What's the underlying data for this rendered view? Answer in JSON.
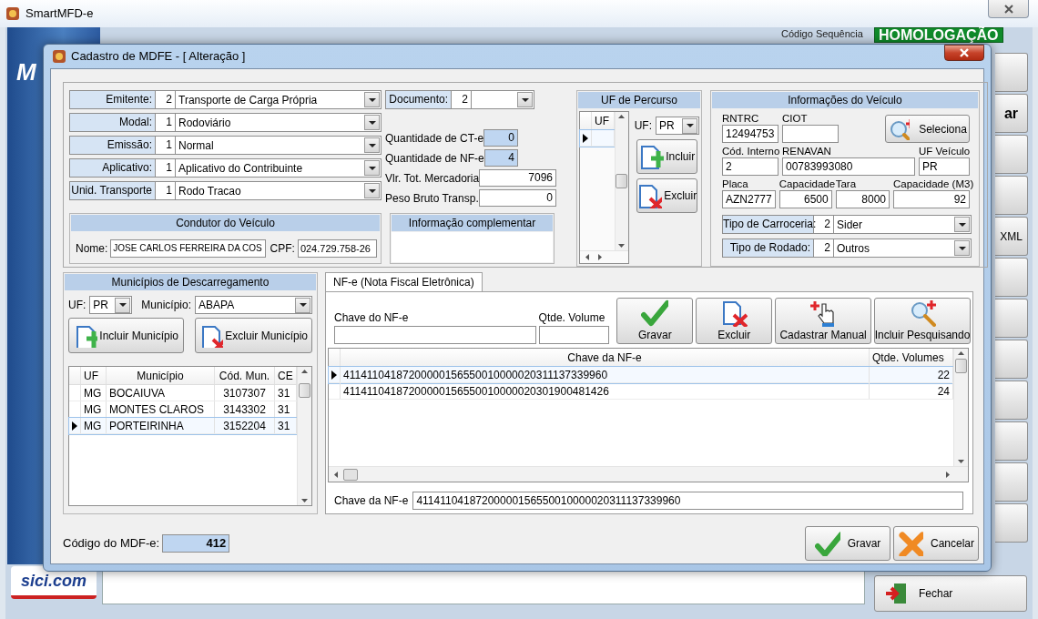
{
  "app": {
    "title": "SmartMFD-e",
    "logo_letter": "M",
    "sequence_label": "Código Sequência",
    "environment": "HOMOLOGAÇÃO",
    "side_buttons": [
      {
        "label": "ar",
        "bold": true
      },
      {
        "label": "XML",
        "bold": false
      }
    ],
    "close_button": "Fechar",
    "footer_logo": "sici.com"
  },
  "dialog": {
    "title": "Cadastro de MDFE - [ Alteração ]"
  },
  "combos": [
    {
      "label": "Emitente:",
      "code": "2",
      "value": "Transporte de Carga Própria"
    },
    {
      "label": "Modal:",
      "code": "1",
      "value": "Rodoviário"
    },
    {
      "label": "Emissão:",
      "code": "1",
      "value": "Normal"
    },
    {
      "label": "Aplicativo:",
      "code": "1",
      "value": "Aplicativo do Contribuinte"
    },
    {
      "label": "Unid. Transporte",
      "code": "1",
      "value": "Rodo Tracao"
    }
  ],
  "document": {
    "label": "Documento:",
    "code": "2"
  },
  "totals": [
    {
      "label": "Quantidade de CT-e",
      "value": "0",
      "readonly": true
    },
    {
      "label": "Quantidade de NF-e",
      "value": "4",
      "readonly": true
    },
    {
      "label": "Vlr. Tot. Mercadoria",
      "value": "7096",
      "readonly": false
    },
    {
      "label": "Peso Bruto Transp.",
      "value": "0",
      "readonly": false
    }
  ],
  "driver": {
    "title": "Condutor do Veículo",
    "name_label": "Nome:",
    "name": "JOSE CARLOS FERREIRA DA COS",
    "cpf_label": "CPF:",
    "cpf": "024.729.758-26"
  },
  "complement": {
    "title": "Informação complementar"
  },
  "route": {
    "title": "UF de Percurso",
    "column": "UF",
    "rows": [
      {
        "selected": true
      }
    ],
    "uf_label": "UF:",
    "uf": "PR",
    "buttons": [
      {
        "label": "Incluir",
        "kind": "add"
      },
      {
        "label": "Excluir",
        "kind": "delete"
      }
    ]
  },
  "vehicle": {
    "title": "Informações do Veículo",
    "select_button": "Seleciona",
    "fields": [
      {
        "label": "RNTRC",
        "value": "12494753",
        "kind": "text"
      },
      {
        "label": "CIOT",
        "kind": "text"
      },
      {
        "label": "Cód. Interno",
        "value": "2",
        "kind": "text"
      },
      {
        "label": "RENAVAN",
        "value": "00783993080",
        "kind": "text"
      },
      {
        "label": "UF Veículo",
        "value": "PR",
        "kind": "text"
      },
      {
        "label": "Placa",
        "value": "AZN2777",
        "kind": "text"
      },
      {
        "label": "Capacidade",
        "value": "6500",
        "kind": "number"
      },
      {
        "label": "Tara",
        "value": "8000",
        "kind": "number"
      },
      {
        "label": "Capacidade (M3)",
        "value": "92",
        "kind": "number"
      }
    ],
    "combos": [
      {
        "label": "Tipo de Carroceria:",
        "code": "2",
        "value": "Sider"
      },
      {
        "label": "Tipo de Rodado:",
        "code": "2",
        "value": "Outros"
      }
    ]
  },
  "municipios": {
    "title": "Municípios de Descarregamento",
    "uf_label": "UF:",
    "uf": "PR",
    "municipio_label": "Município:",
    "municipio": "ABAPA",
    "buttons": [
      {
        "label": "Incluir Município",
        "kind": "add"
      },
      {
        "label": "Excluir Município",
        "kind": "delete"
      }
    ],
    "columns": [
      "UF",
      "Município",
      "Cód. Mun.",
      "CE"
    ],
    "rows": [
      {
        "cells": [
          "MG",
          "BOCAIUVA",
          "3107307",
          "31"
        ],
        "selected": false
      },
      {
        "cells": [
          "MG",
          "MONTES CLAROS",
          "3143302",
          "31"
        ],
        "selected": false
      },
      {
        "cells": [
          "MG",
          "PORTEIRINHA",
          "3152204",
          "31"
        ],
        "selected": true
      }
    ]
  },
  "nfe": {
    "tabs": [
      {
        "label": "NF-e (Nota Fiscal Eletrônica)",
        "selected": true
      }
    ],
    "key_label": "Chave do NF-e",
    "volume_label": "Qtde. Volume",
    "buttons": [
      {
        "label": "Gravar",
        "kind": "save"
      },
      {
        "label": "Excluir",
        "kind": "delete"
      },
      {
        "label": "Cadastrar Manual",
        "kind": "manual"
      },
      {
        "label": "Incluir Pesquisando",
        "kind": "search"
      }
    ],
    "columns": [
      "Chave da NF-e",
      "Qtde. Volumes"
    ],
    "rows": [
      {
        "cells": [
          "41141104187200000156550010000020311137339960",
          "22"
        ],
        "selected": true
      },
      {
        "cells": [
          "41141104187200000156550010000020301900481426",
          "24"
        ],
        "selected": false
      }
    ],
    "selected_label": "Chave da NF-e",
    "selected_key": "41141104187200000156550010000020311137339960"
  },
  "footer": {
    "code_label": "Código do MDF-e:",
    "code": "412",
    "buttons": [
      {
        "label": "Gravar",
        "kind": "save"
      },
      {
        "label": "Cancelar",
        "kind": "cancel"
      }
    ]
  }
}
